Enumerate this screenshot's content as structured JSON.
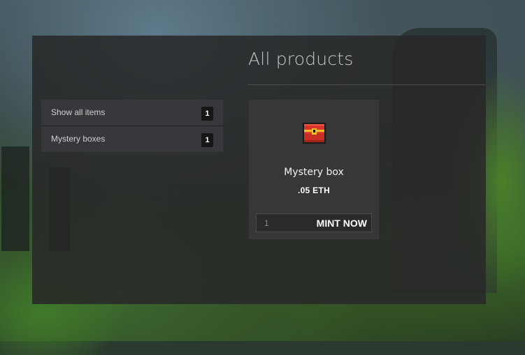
{
  "page": {
    "title": "All products"
  },
  "sidebar": {
    "items": [
      {
        "label": "Show all items",
        "count": "1"
      },
      {
        "label": "Mystery boxes",
        "count": "1"
      }
    ]
  },
  "products": [
    {
      "icon": "treasure-chest-icon",
      "name": "Mystery box",
      "price": ".05 ETH",
      "quantity_value": "1",
      "mint_label": "MINT NOW"
    }
  ],
  "colors": {
    "panel_bg": "#282828",
    "sidebar_item_bg": "#36383b",
    "badge_bg": "#161616",
    "chest_red": "#d8352a",
    "chest_gold": "#f0c020"
  }
}
